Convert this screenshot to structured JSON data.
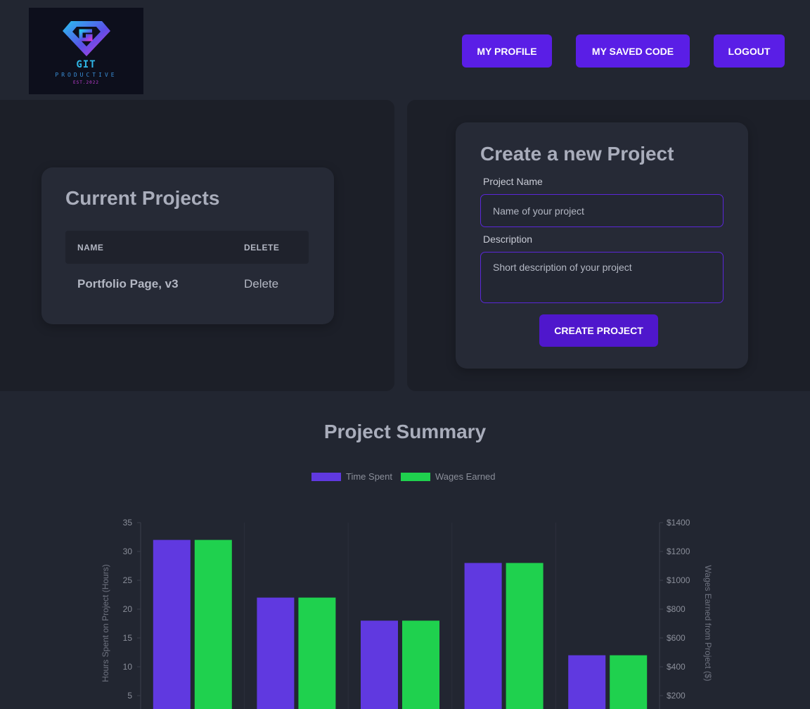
{
  "header": {
    "logo": {
      "line1": "GIT",
      "line2": "PRODUCTIVE",
      "line3": "EST.2022"
    },
    "nav": [
      {
        "label": "MY PROFILE"
      },
      {
        "label": "MY SAVED CODE"
      },
      {
        "label": "LOGOUT"
      }
    ]
  },
  "current_projects": {
    "title": "Current Projects",
    "columns": [
      "NAME",
      "DELETE"
    ],
    "rows": [
      {
        "name": "Portfolio Page, v3",
        "delete_label": "Delete"
      }
    ]
  },
  "new_project": {
    "title": "Create a new Project",
    "name_label": "Project Name",
    "name_placeholder": "Name of your project",
    "description_label": "Description",
    "description_placeholder": "Short description of your project",
    "submit_label": "CREATE PROJECT"
  },
  "summary": {
    "title": "Project Summary"
  },
  "colors": {
    "accent": "#5a1ee6",
    "time_spent": "#6039e0",
    "wages_earned": "#1fd14e",
    "background": "#222631"
  },
  "chart_data": {
    "type": "bar",
    "categories": [
      "",
      "",
      "",
      "",
      ""
    ],
    "series": [
      {
        "name": "Time Spent",
        "axis": "left",
        "values": [
          32,
          22,
          18,
          28,
          12
        ]
      },
      {
        "name": "Wages Earned",
        "axis": "right",
        "values": [
          1280,
          880,
          720,
          1120,
          480
        ]
      }
    ],
    "ylabel": "Hours Spent on Project (Hours)",
    "ylabel_right": "Wages Earned from Project ($)",
    "ylim": [
      0,
      35
    ],
    "ylim_right": [
      0,
      1400
    ],
    "yticks": [
      "5",
      "10",
      "15",
      "20",
      "25",
      "30",
      "35"
    ],
    "yticks_right": [
      "$200",
      "$400",
      "$600",
      "$800",
      "$1000",
      "$1200",
      "$1400"
    ],
    "legend": "top-center",
    "grid": true
  }
}
